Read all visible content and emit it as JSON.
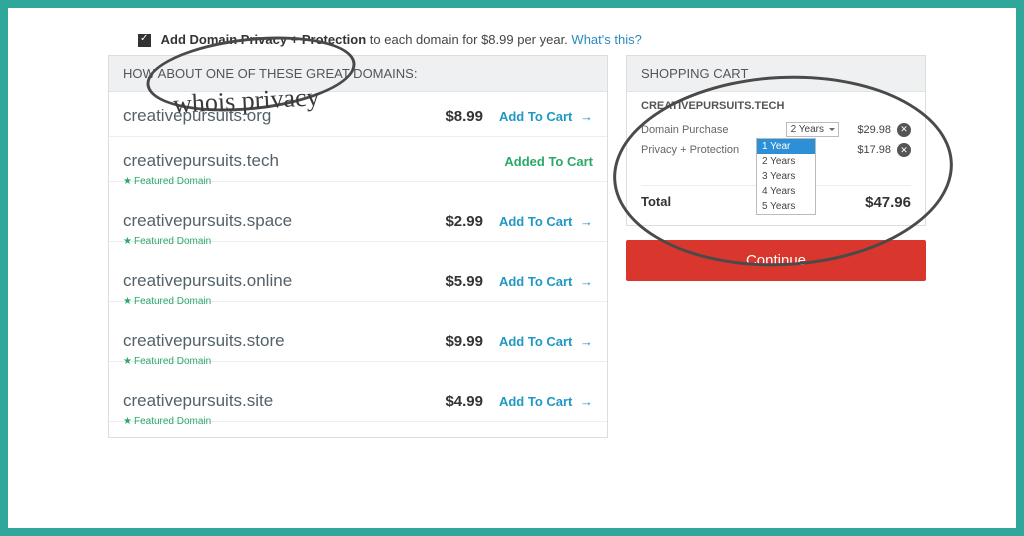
{
  "privacy": {
    "label_bold": "Add Domain Privacy + Protection",
    "label_rest": " to each domain for $8.99 per year.",
    "whats_this": "What's this?"
  },
  "annotation": {
    "handwritten": "whois privacy"
  },
  "domains_header": "HOW ABOUT ONE OF THESE GREAT DOMAINS:",
  "domains": [
    {
      "name": "creativepursuits.org",
      "price": "$8.99",
      "cta": "Add To Cart",
      "featured": false,
      "added": false
    },
    {
      "name": "creativepursuits.tech",
      "price": "",
      "cta": "Added To Cart",
      "featured": true,
      "added": true
    },
    {
      "name": "creativepursuits.space",
      "price": "$2.99",
      "cta": "Add To Cart",
      "featured": true,
      "added": false
    },
    {
      "name": "creativepursuits.online",
      "price": "$5.99",
      "cta": "Add To Cart",
      "featured": true,
      "added": false
    },
    {
      "name": "creativepursuits.store",
      "price": "$9.99",
      "cta": "Add To Cart",
      "featured": true,
      "added": false
    },
    {
      "name": "creativepursuits.site",
      "price": "$4.99",
      "cta": "Add To Cart",
      "featured": true,
      "added": false
    }
  ],
  "featured_label": "Featured Domain",
  "cart": {
    "header": "SHOPPING CART",
    "domain_title": "CREATIVEPURSUITS.TECH",
    "lines": [
      {
        "label": "Domain Purchase",
        "selected": "2 Years",
        "amount": "$29.98"
      },
      {
        "label": "Privacy + Protection",
        "selected": "",
        "amount": "$17.98"
      }
    ],
    "options": [
      "1 Year",
      "2 Years",
      "3 Years",
      "4 Years",
      "5 Years"
    ],
    "total_label": "Total",
    "total": "$47.96"
  },
  "continue_label": "Continue"
}
